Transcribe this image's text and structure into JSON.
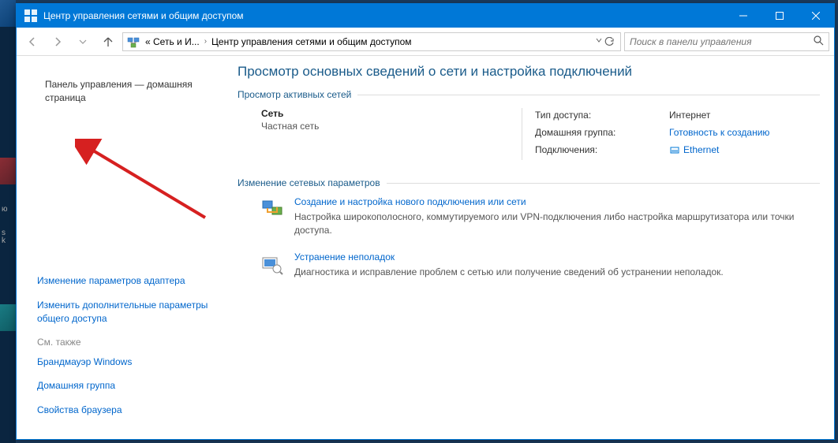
{
  "window": {
    "title": "Центр управления сетями и общим доступом"
  },
  "addressbar": {
    "segment1": "« Сеть и И...",
    "segment2": "Центр управления сетями и общим доступом",
    "search_placeholder": "Поиск в панели управления"
  },
  "sidebar": {
    "home": "Панель управления — домашняя страница",
    "link1": "Изменение параметров адаптера",
    "link2": "Изменить дополнительные параметры общего доступа",
    "footer_hdr": "См. также",
    "footer1": "Брандмауэр Windows",
    "footer2": "Домашняя группа",
    "footer3": "Свойства браузера"
  },
  "main": {
    "title": "Просмотр основных сведений о сети и настройка подключений",
    "sec_active": "Просмотр активных сетей",
    "network": {
      "name": "Сеть",
      "type": "Частная сеть",
      "access_label": "Тип доступа:",
      "access_value": "Интернет",
      "homegroup_label": "Домашняя группа:",
      "homegroup_value": "Готовность к созданию",
      "connections_label": "Подключения:",
      "connections_value": "Ethernet"
    },
    "sec_change": "Изменение сетевых параметров",
    "task1": {
      "title": "Создание и настройка нового подключения или сети",
      "desc": "Настройка широкополосного, коммутируемого или VPN-подключения либо настройка маршрутизатора или точки доступа."
    },
    "task2": {
      "title": "Устранение неполадок",
      "desc": "Диагностика и исправление проблем с сетью или получение сведений об устранении неполадок."
    }
  }
}
